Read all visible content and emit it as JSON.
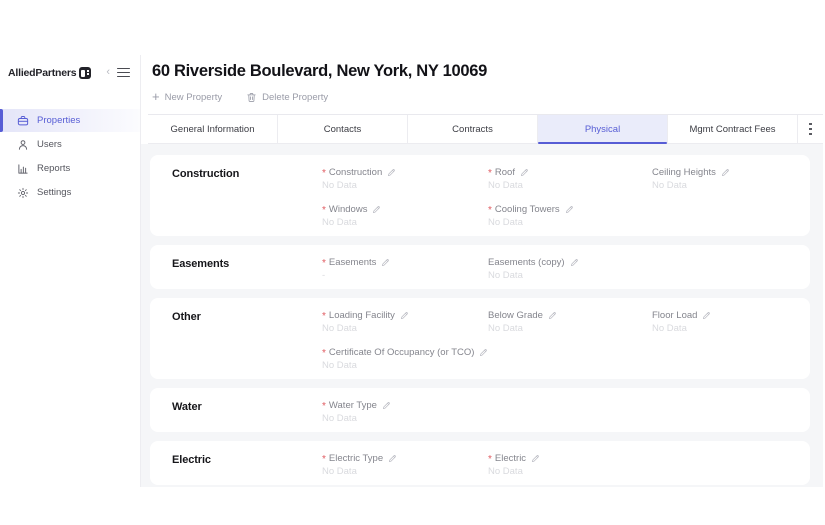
{
  "sidebar": {
    "logo": "AlliedPartners",
    "items": [
      {
        "label": "Properties",
        "icon": "briefcase-icon",
        "active": true
      },
      {
        "label": "Users",
        "icon": "user-icon",
        "active": false
      },
      {
        "label": "Reports",
        "icon": "bar-chart-icon",
        "active": false
      },
      {
        "label": "Settings",
        "icon": "gear-icon",
        "active": false
      }
    ]
  },
  "header": {
    "title": "60 Riverside Boulevard, New York, NY 10069",
    "new_property_label": "New Property",
    "delete_property_label": "Delete Property"
  },
  "tabs": [
    {
      "label": "General Information",
      "active": false
    },
    {
      "label": "Contacts",
      "active": false
    },
    {
      "label": "Contracts",
      "active": false
    },
    {
      "label": "Physical",
      "active": true
    },
    {
      "label": "Mgmt Contract Fees",
      "active": false
    }
  ],
  "colors": {
    "accent": "#575dd5",
    "active_tab_bg": "#eaecfa",
    "required_marker": "#e05c62",
    "content_bg": "#f5f6f8",
    "no_data_text": "#d9dade"
  },
  "sections": [
    {
      "title": "Construction",
      "rows": [
        [
          {
            "required": true,
            "label": "Construction",
            "value": "No Data"
          },
          {
            "required": true,
            "label": "Roof",
            "value": "No Data"
          },
          {
            "required": false,
            "label": "Ceiling Heights",
            "value": "No Data"
          }
        ],
        [
          {
            "required": true,
            "label": "Windows",
            "value": "No Data"
          },
          {
            "required": true,
            "label": "Cooling Towers",
            "value": "No Data"
          }
        ]
      ]
    },
    {
      "title": "Easements",
      "rows": [
        [
          {
            "required": true,
            "label": "Easements",
            "value": "-"
          },
          {
            "required": false,
            "label": "Easements (copy)",
            "value": "No Data"
          }
        ]
      ]
    },
    {
      "title": "Other",
      "rows": [
        [
          {
            "required": true,
            "label": "Loading Facility",
            "value": "No Data"
          },
          {
            "required": false,
            "label": "Below Grade",
            "value": "No Data"
          },
          {
            "required": false,
            "label": "Floor Load",
            "value": "No Data"
          }
        ],
        [
          {
            "required": true,
            "label": "Certificate Of Occupancy (or TCO)",
            "value": "No Data"
          }
        ]
      ]
    },
    {
      "title": "Water",
      "rows": [
        [
          {
            "required": true,
            "label": "Water Type",
            "value": "No Data"
          }
        ]
      ]
    },
    {
      "title": "Electric",
      "rows": [
        [
          {
            "required": true,
            "label": "Electric Type",
            "value": "No Data"
          },
          {
            "required": true,
            "label": "Electric",
            "value": "No Data"
          }
        ]
      ]
    }
  ]
}
